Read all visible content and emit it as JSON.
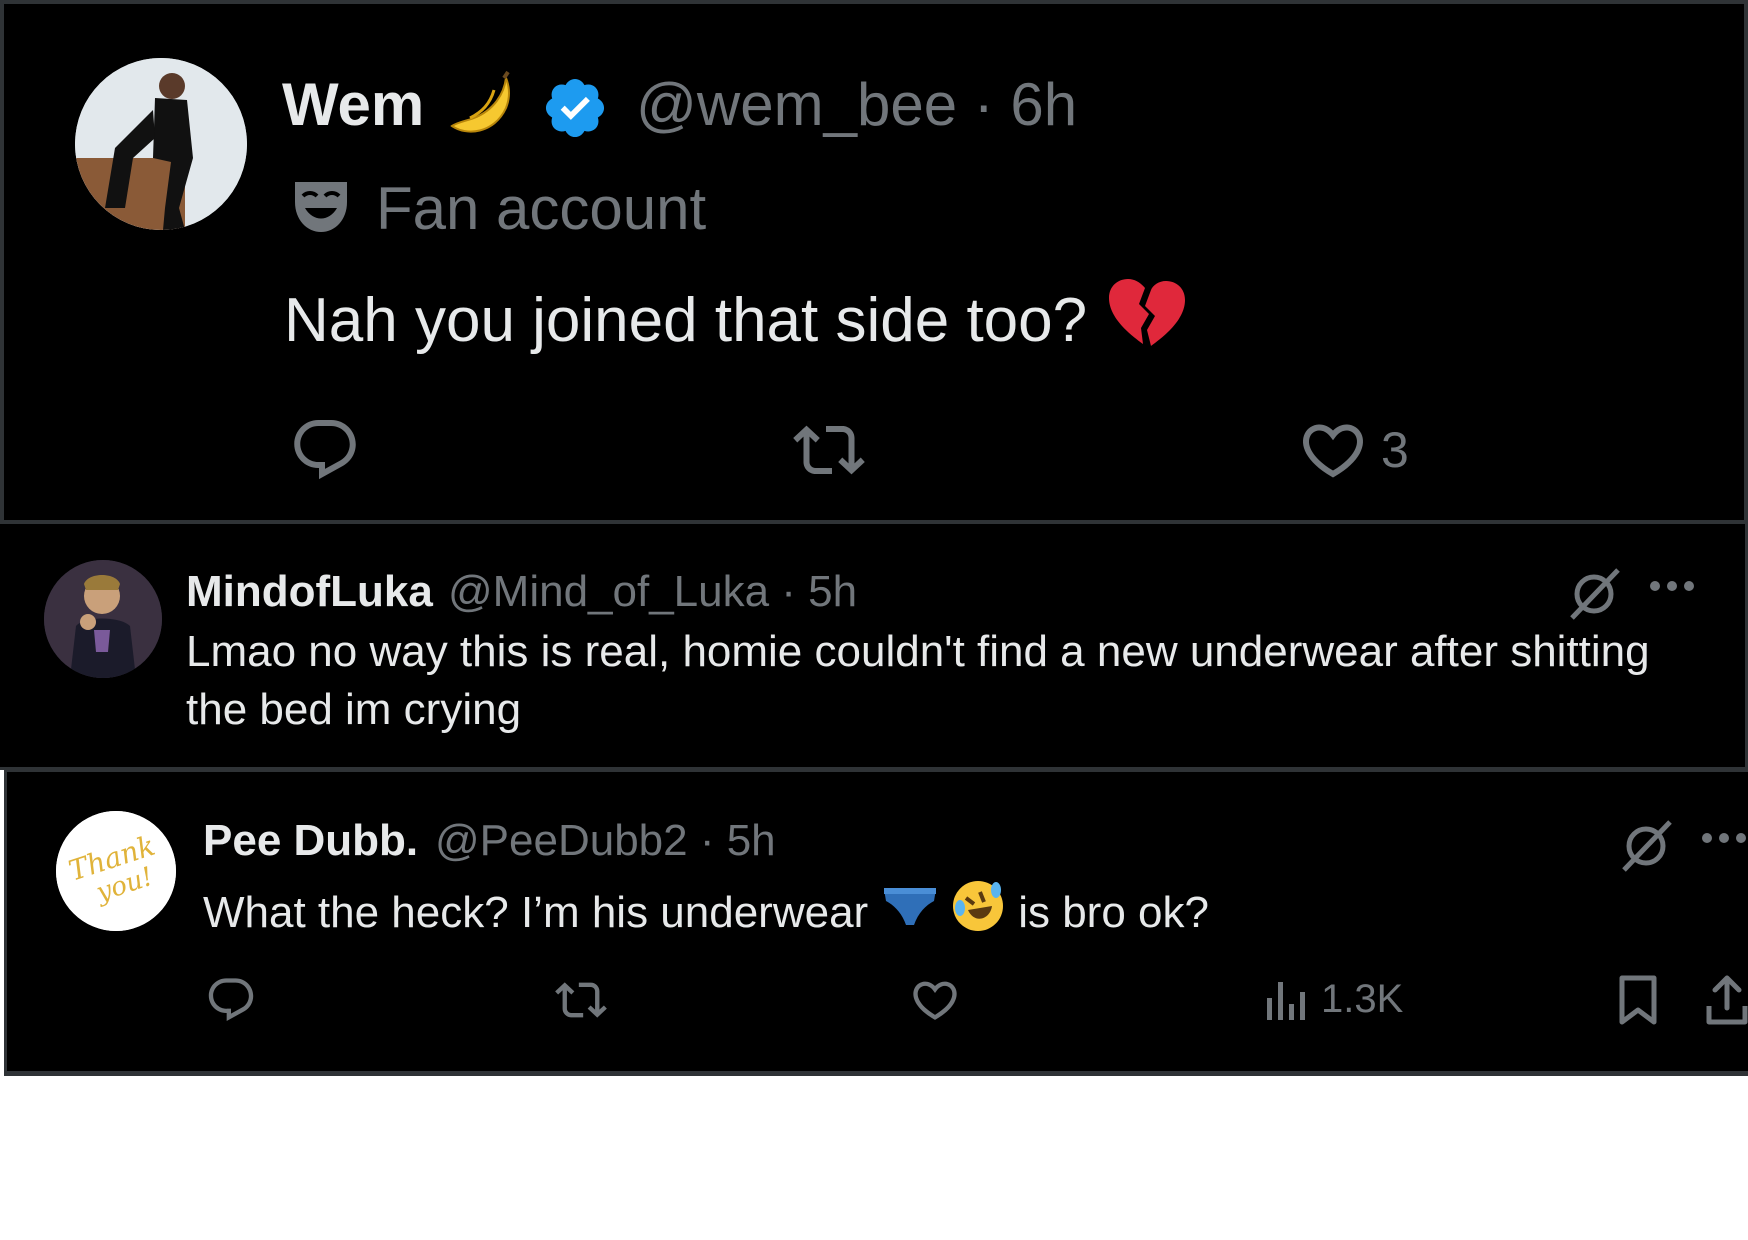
{
  "tweet": {
    "author_name": "Wem",
    "handle_time": "@wem_bee · 6h",
    "fan_label": "Fan account",
    "text": "Nah you joined that side too?",
    "like_count": "3",
    "icons": [
      "banana-emoji",
      "verified-badge-icon",
      "mask-icon",
      "broken-heart-emoji",
      "reply-icon",
      "retweet-icon",
      "like-icon"
    ],
    "colors": {
      "background": "#000000",
      "text": "#e7e9ea",
      "muted": "#71767b",
      "verified": "#1d9bf0"
    }
  },
  "reply1": {
    "author_name": "MindofLuka",
    "handle_time": "@Mind_of_Luka · 5h",
    "text_line1": "Lmao no way this is real, homie couldn't find a new underwear after shitting",
    "text_line2": "the bed im crying",
    "icons": [
      "grok-icon",
      "more-icon"
    ]
  },
  "reply2": {
    "author_name": "Pee Dubb.",
    "handle_time": "@PeeDubb2 · 5h",
    "text_part1": "What the heck? I’m his underwear",
    "text_part2": "is bro ok?",
    "avatar_text": "Thank you!",
    "views": "1.3K",
    "icons": [
      "briefs-emoji",
      "rolling-laughing-emoji",
      "grok-icon",
      "more-icon",
      "reply-icon",
      "retweet-icon",
      "like-icon",
      "views-icon",
      "bookmark-icon",
      "share-icon"
    ]
  }
}
